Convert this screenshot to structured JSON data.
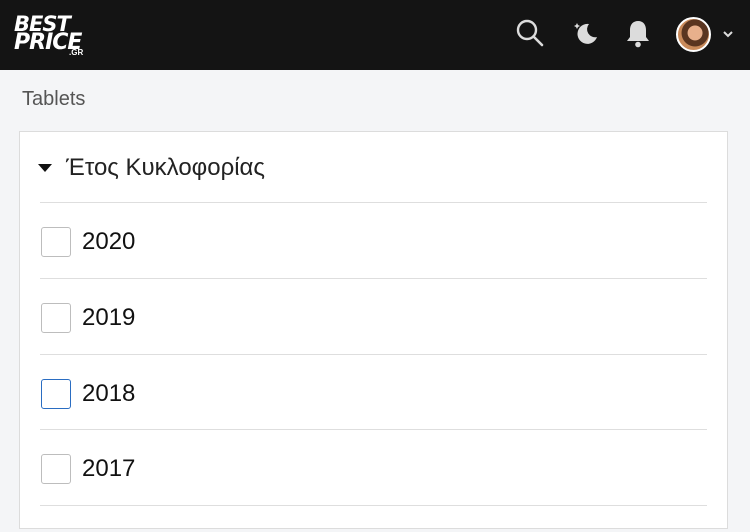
{
  "header": {
    "logo": {
      "line1": "BEST",
      "line2": "PRICE",
      "tld": ".GR"
    },
    "icons": [
      "search-icon",
      "dark-mode-icon",
      "bell-icon",
      "avatar",
      "chevron-down-icon"
    ],
    "colors": {
      "background": "#141414",
      "icon": "#dcdcdc"
    }
  },
  "breadcrumb": "Tablets",
  "filter": {
    "title": "Έτος Κυκλοφορίας",
    "options": [
      {
        "label": "2020",
        "checked": false
      },
      {
        "label": "2019",
        "checked": false
      },
      {
        "label": "2018",
        "checked": false,
        "focused": true
      },
      {
        "label": "2017",
        "checked": false
      }
    ]
  }
}
